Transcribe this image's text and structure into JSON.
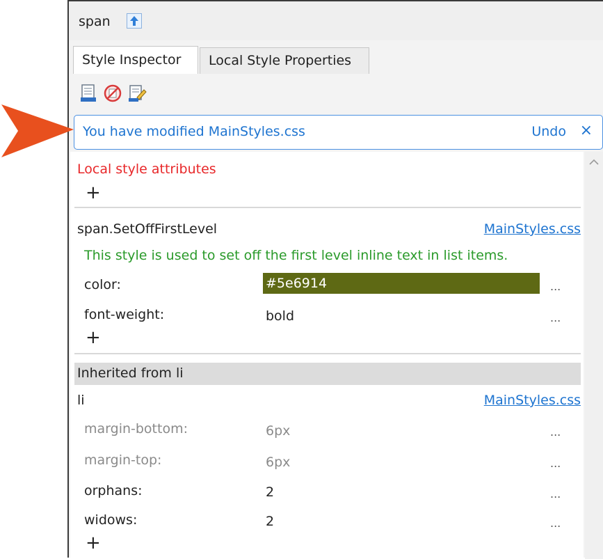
{
  "header": {
    "element_name": "span"
  },
  "tabs": [
    {
      "label": "Style Inspector",
      "active": true
    },
    {
      "label": "Local Style Properties",
      "active": false
    }
  ],
  "notification": {
    "prefix": "You have modified",
    "file": "MainStyles.css",
    "undo_label": "Undo",
    "close_label": "×"
  },
  "local_section": {
    "title": "Local style attributes",
    "add_label": "+"
  },
  "rules": [
    {
      "selector": "span.SetOffFirstLevel",
      "source": "MainStyles.css",
      "description": "This style is used to set off the first level inline text in list items.",
      "properties": [
        {
          "name": "color:",
          "value": "#5e6914",
          "swatch": "#5e6914"
        },
        {
          "name": "font-weight:",
          "value": "bold"
        }
      ],
      "add_label": "+"
    },
    {
      "inherited_label": "Inherited from li",
      "selector": "li",
      "source": "MainStyles.css",
      "properties": [
        {
          "name": "margin-bottom:",
          "value": "6px",
          "muted": true
        },
        {
          "name": "margin-top:",
          "value": "6px",
          "muted": true
        },
        {
          "name": "orphans:",
          "value": "2"
        },
        {
          "name": "widows:",
          "value": "2"
        }
      ],
      "add_label": "+"
    }
  ],
  "more_label": "...",
  "colors": {
    "accent": "#1e74d0",
    "callout_arrow": "#e8501e",
    "local_title": "#e8282a",
    "description": "#2a9a2a"
  },
  "icons": [
    "arrow-up-icon",
    "new-style-icon",
    "no-style-icon",
    "edit-style-icon",
    "chevron-up-icon",
    "callout-arrow-icon"
  ]
}
